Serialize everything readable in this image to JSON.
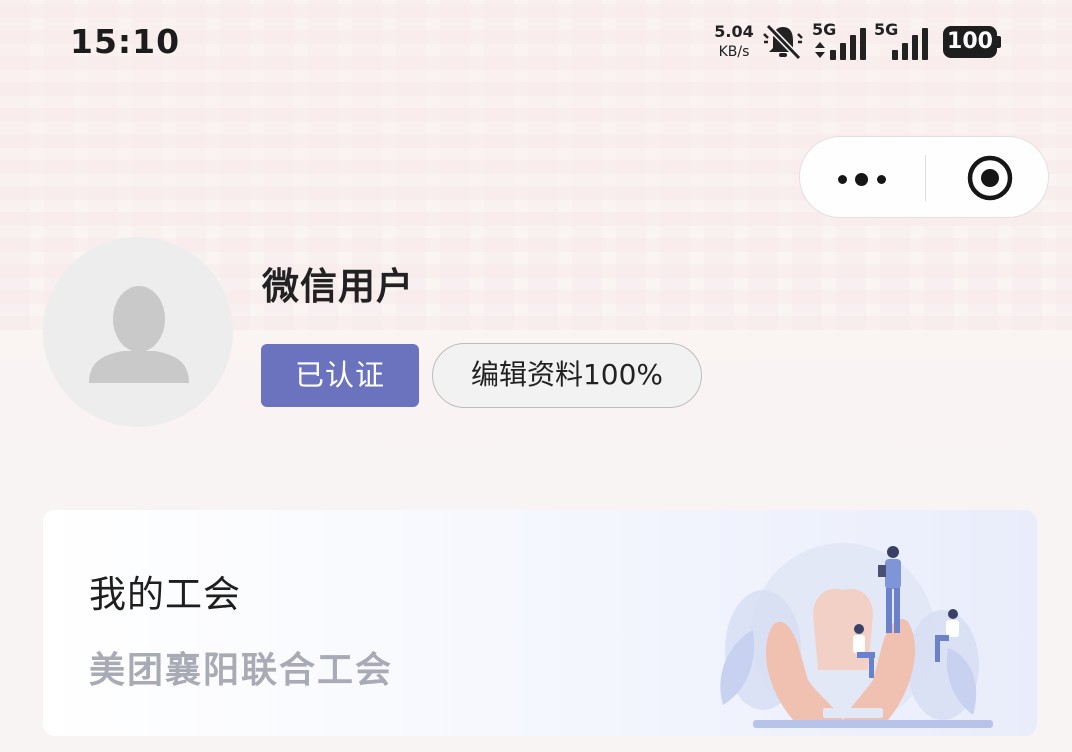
{
  "status_bar": {
    "time": "15:10",
    "net_speed_value": "5.04",
    "net_speed_unit": "KB/s",
    "signal1_label": "5G",
    "signal2_label": "5G",
    "battery": "100"
  },
  "capsule": {
    "more_icon": "more-dots-icon",
    "close_icon": "target-close-icon"
  },
  "profile": {
    "avatar_icon": "default-avatar-icon",
    "username": "微信用户",
    "verified_label": "已认证",
    "edit_label": "编辑资料100%"
  },
  "union_card": {
    "title": "我的工会",
    "subtitle": "美团襄阳联合工会",
    "illustration": "union-hands-illustration"
  },
  "colors": {
    "accent": "#6b73bf",
    "subtitle_gray": "#a8aab5"
  }
}
